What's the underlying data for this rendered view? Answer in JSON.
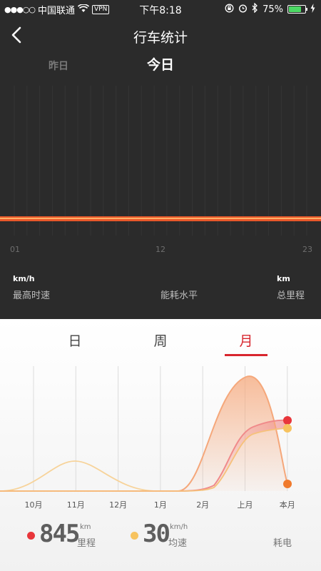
{
  "status_bar": {
    "signal": "●●●○○",
    "carrier": "中国联通",
    "vpn": "VPN",
    "time": "下午8:18",
    "battery": "75%",
    "battery_level": 0.75
  },
  "nav": {
    "title": "行车统计"
  },
  "day_selector": {
    "yesterday": "昨日",
    "today": "今日"
  },
  "hour_axis": {
    "ticks": [
      "01",
      "12",
      "23"
    ]
  },
  "day_stats": [
    {
      "unit": "km/h",
      "label": "最高时速"
    },
    {
      "unit": "",
      "label": "能耗水平"
    },
    {
      "unit": "km",
      "label": "总里程"
    }
  ],
  "tabs": [
    "日",
    "周",
    "月"
  ],
  "active_tab": "月",
  "colors": {
    "accent": "#d8262e",
    "hour_line": "#e8582a",
    "mileage": "#e8363b",
    "speed": "#f7c35f",
    "energy": "#f07a2c",
    "curve_fill": "#f5b48a"
  },
  "chart_data": {
    "type": "area",
    "x": [
      "10月",
      "11月",
      "12月",
      "1月",
      "2月",
      "上月",
      "本月"
    ],
    "legend": [
      {
        "name": "里程",
        "value": "845",
        "unit": "km"
      },
      {
        "name": "均速",
        "value": "30",
        "unit": "km/h"
      },
      {
        "name": "耗电",
        "value": "",
        "unit": ""
      }
    ]
  }
}
